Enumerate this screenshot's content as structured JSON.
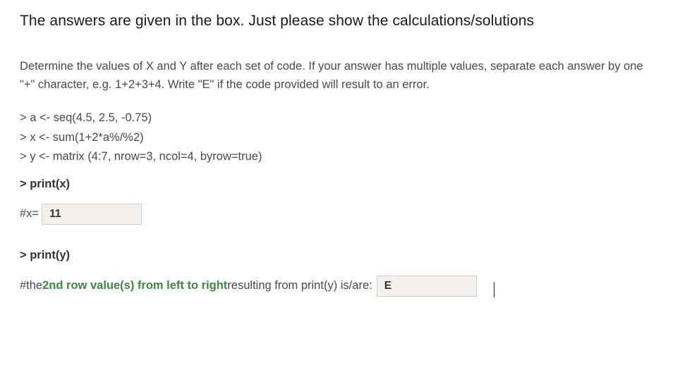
{
  "title": "The answers are given in the box. Just please show the calculations/solutions",
  "instructions": "Determine the values of X and Y after each set of code. If your answer has multiple values, separate each answer by one \"+\" character, e.g. 1+2+3+4. Write \"E\" if the code provided will result to an error.",
  "code": {
    "line1": "> a <- seq(4.5, 2.5, -0.75)",
    "line2": "> x <- sum(1+2*a%/%2)",
    "line3": "> y <- matrix (4:7, nrow=3, ncol=4, byrow=true)"
  },
  "print_x": "> print(x)",
  "answer_x_label": "#x=",
  "answer_x_value": "11",
  "print_y": "> print(y)",
  "footer_prefix": "#the ",
  "footer_green": "2nd row value(s) from left to right",
  "footer_suffix": " resulting from print(y) is/are:",
  "answer_y_value": "E"
}
